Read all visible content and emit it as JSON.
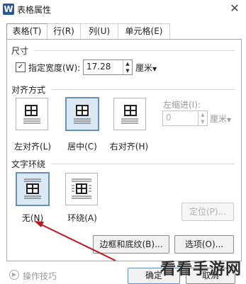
{
  "window": {
    "title": "表格属性",
    "app_icon_letter": "W"
  },
  "tabs": [
    {
      "label": "表格(T)",
      "active": true
    },
    {
      "label": "行(R)",
      "active": false
    },
    {
      "label": "列(U)",
      "active": false
    },
    {
      "label": "单元格(E)",
      "active": false
    }
  ],
  "size": {
    "section_label": "尺寸",
    "width_checkbox_label": "指定宽度(W):",
    "width_checked": true,
    "width_value": "17.28",
    "unit_label": "厘米"
  },
  "alignment": {
    "section_label": "对齐方式",
    "options": [
      {
        "label": "左对齐(L)",
        "selected": false
      },
      {
        "label": "居中(C)",
        "selected": true
      },
      {
        "label": "右对齐(H)",
        "selected": false
      }
    ],
    "indent_label": "左缩进(I):",
    "indent_value": "0",
    "indent_unit": "厘米"
  },
  "wrap": {
    "section_label": "文字环绕",
    "options": [
      {
        "label": "无(N)",
        "selected": true
      },
      {
        "label": "环绕(A)",
        "selected": false
      }
    ],
    "position_button": "定位(P)..."
  },
  "buttons": {
    "borders": "边框和底纹(B)...",
    "options": "选项(O)...",
    "ok": "确定",
    "cancel": "取消"
  },
  "footer": {
    "tips": "操作技巧"
  },
  "watermark": "看看手游网",
  "colors": {
    "selection": "#dbe8f5",
    "arrow": "#c0151d"
  }
}
